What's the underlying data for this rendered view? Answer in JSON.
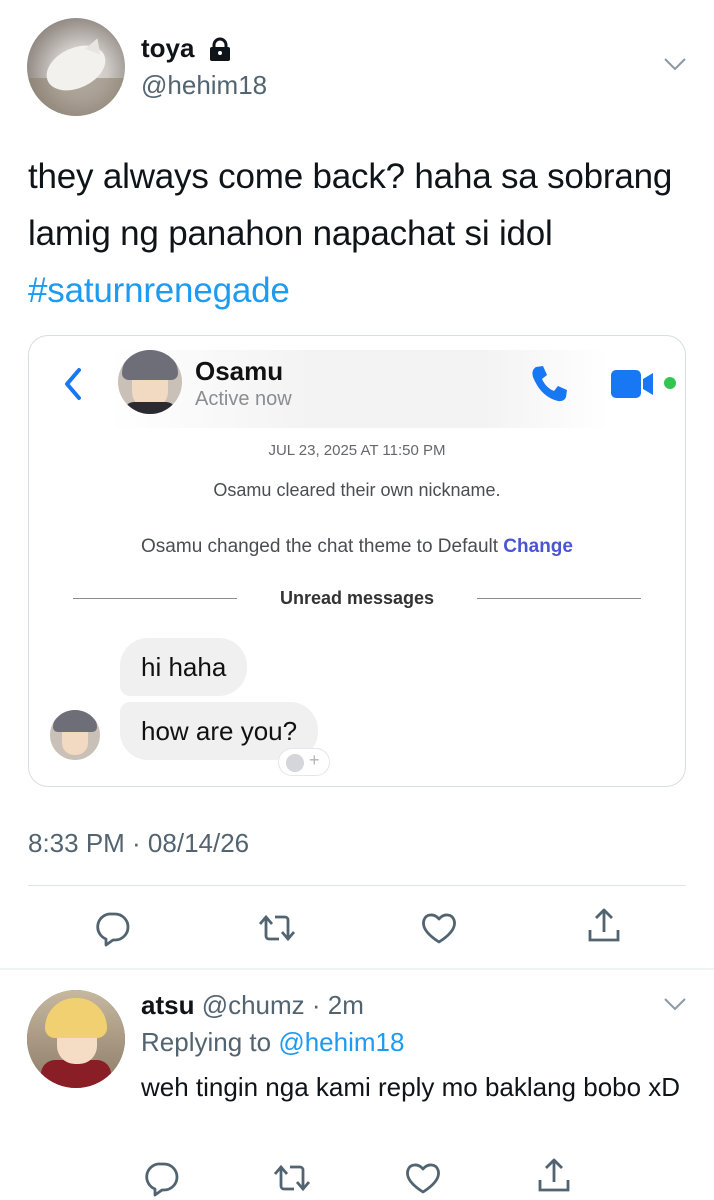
{
  "tweet": {
    "name": "toya",
    "handle": "@hehim18",
    "text_before": "they always come back? haha sa sobrang lamig ng panahon napachat si idol ",
    "hashtag": "#saturnrenegade",
    "time": "8:33 PM · 08/14/26"
  },
  "chat": {
    "contact_name": "Osamu",
    "status": "Active now",
    "timestamp": "JUL 23, 2025 AT 11:50 PM",
    "system_1": "Osamu cleared their own nickname.",
    "system_2_text": "Osamu changed the chat theme to Default ",
    "system_2_link": "Change",
    "divider_label": "Unread messages",
    "messages": [
      "hi haha",
      "how are you?"
    ],
    "reaction_plus": "+"
  },
  "reply": {
    "name": "atsu",
    "handle_time": " @chumz · 2m",
    "replying_prefix": "Replying to ",
    "replying_mention": "@hehim18",
    "text": "weh tingin nga kami reply mo baklang bobo xD"
  },
  "colors": {
    "link_blue": "#1d9bf0",
    "messenger_blue": "#1877f2",
    "active_green": "#31c552",
    "muted": "#536471"
  },
  "icons": [
    "lock-icon",
    "chevron-down-icon",
    "back-icon",
    "phone-icon",
    "video-icon",
    "reply-icon",
    "retweet-icon",
    "like-icon",
    "share-icon"
  ]
}
